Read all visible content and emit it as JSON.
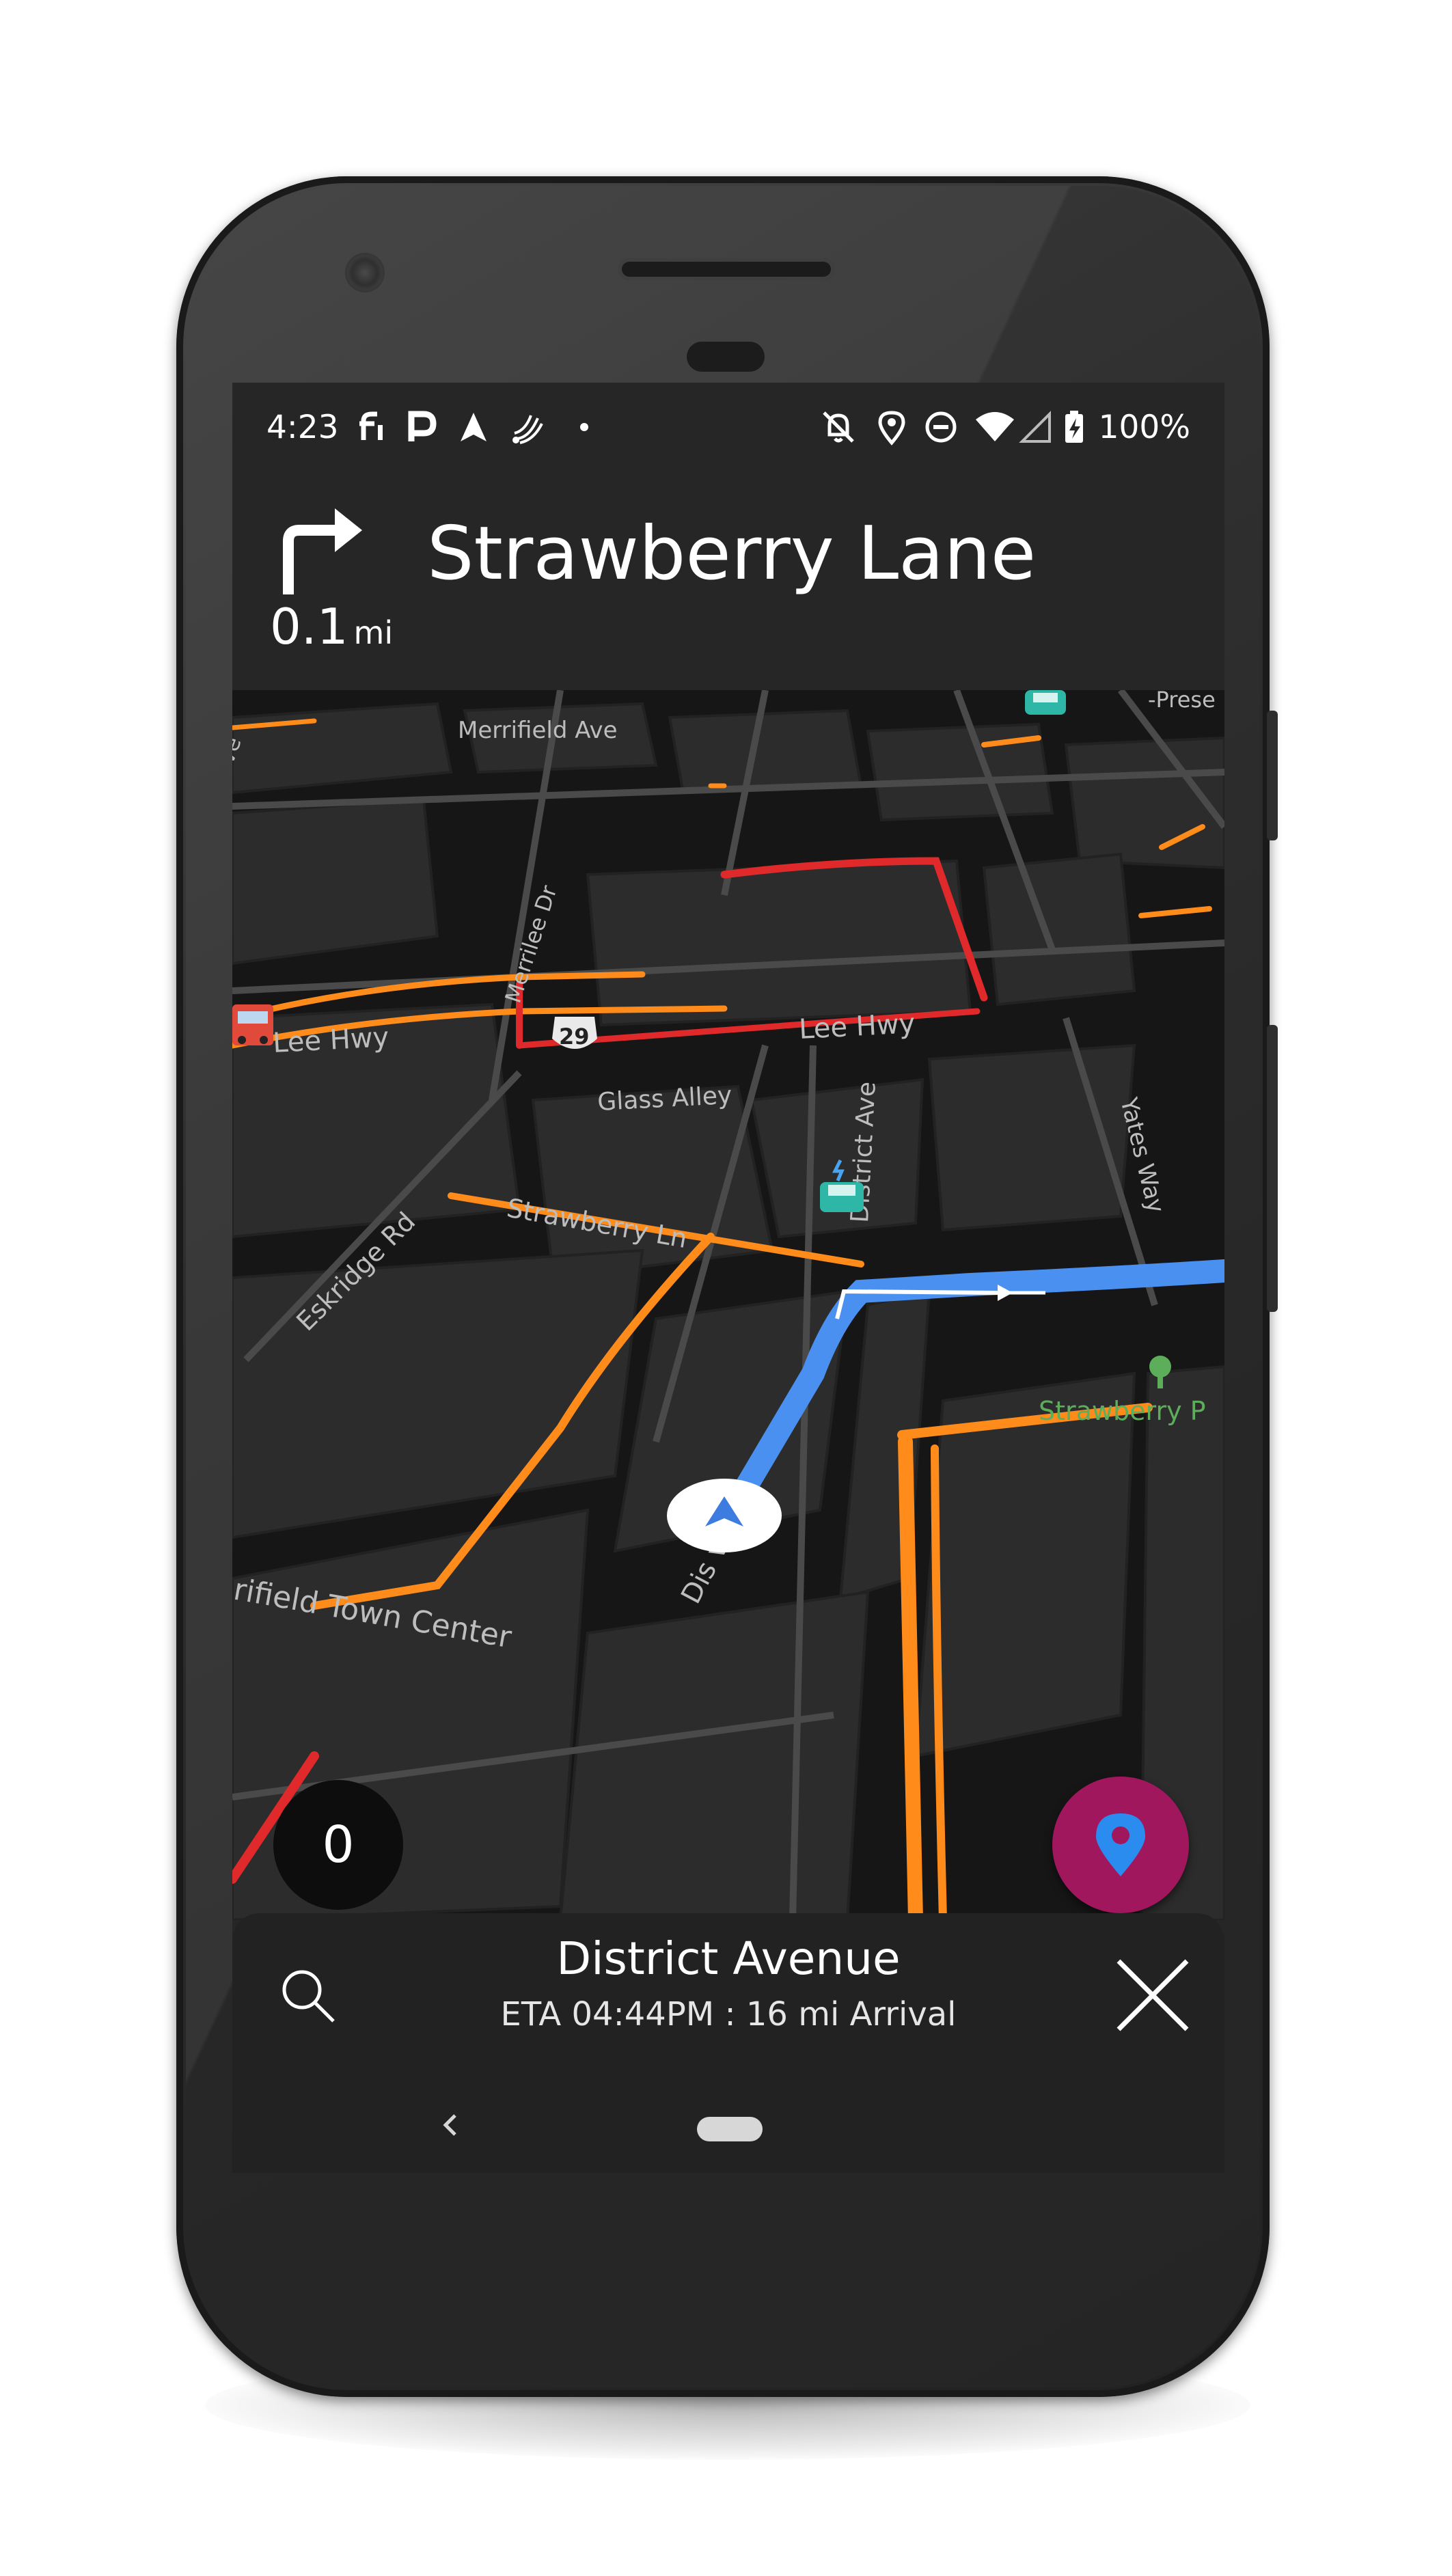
{
  "status_bar": {
    "time": "4:23",
    "battery": "100%",
    "left_icons": [
      "fi-icon",
      "parking-icon",
      "navigation-arrow-icon",
      "nfc-icon",
      "dot-icon"
    ],
    "right_icons": [
      "alarm-off-icon",
      "location-icon",
      "do-not-disturb-icon",
      "wifi-icon",
      "signal-icon",
      "battery-charging-icon"
    ]
  },
  "navigation": {
    "maneuver": "turn-right",
    "distance_value": "0.1",
    "distance_unit": "mi",
    "street": "Strawberry Lane"
  },
  "map": {
    "labels": {
      "merrifield_ave": "Merrifield Ave",
      "merrilee_dr": "Merrilee Dr",
      "lee_hwy_left": "Lee Hwy",
      "lee_hwy_right": "Lee Hwy",
      "route_29": "29",
      "glass_alley": "Glass Alley",
      "district_ave_upper": "District Ave",
      "yates_way": "Yates Way",
      "eskridge_rd": "Eskridge Rd",
      "strawberry_ln": "Strawberry Ln",
      "strawberry_park": "Strawberry P",
      "merrifield_town_center": "rifield Town Center",
      "district_ave_lower": "Dis   ve",
      "prese": "-Prese",
      "ave_edge": "ve"
    },
    "compass_value": "0",
    "colors": {
      "route": "#4a90f0",
      "traffic_moderate": "#ff8c1a",
      "traffic_heavy": "#e0292a",
      "fab": "#a0175e"
    }
  },
  "bottom_sheet": {
    "destination": "District Avenue",
    "eta": "ETA 04:44PM : 16 mi Arrival"
  }
}
